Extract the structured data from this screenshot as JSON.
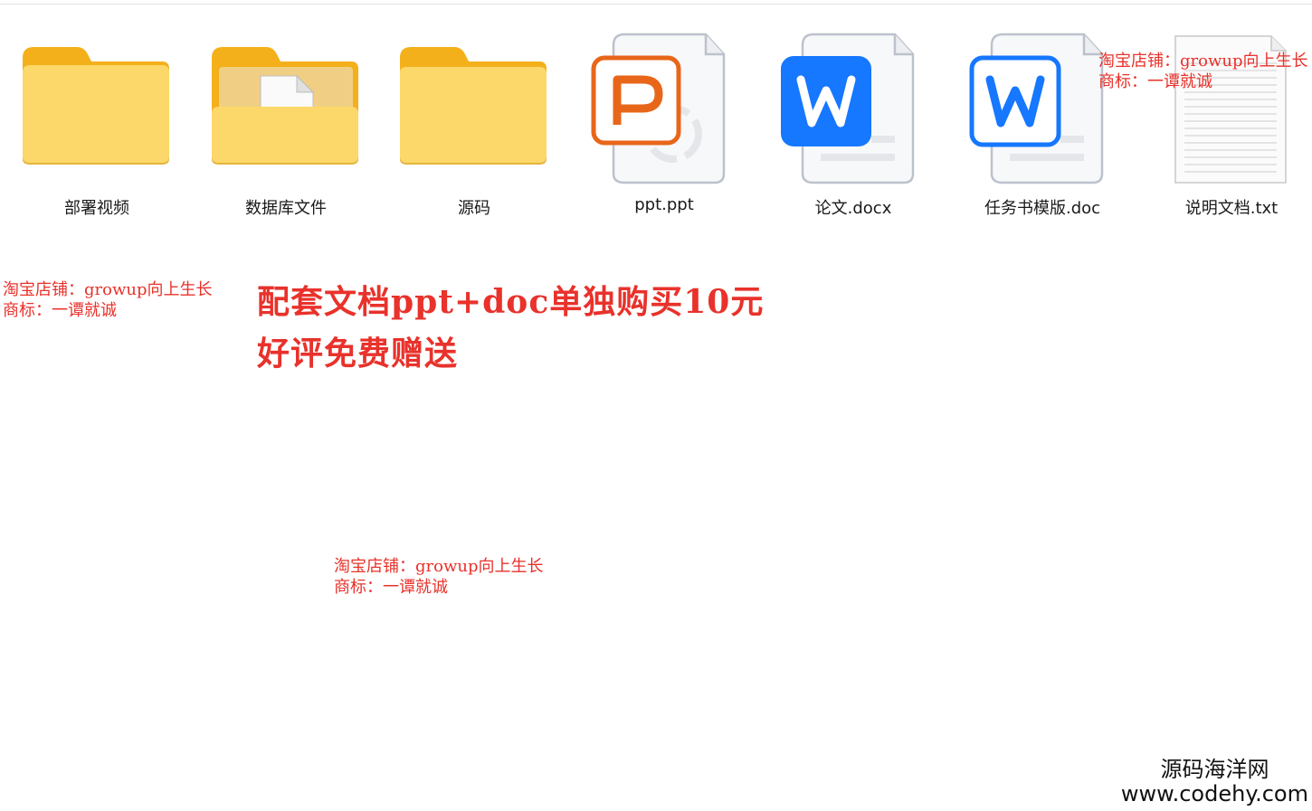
{
  "files": [
    {
      "name": "部署视频",
      "type": "folder"
    },
    {
      "name": "数据库文件",
      "type": "folder-with-document"
    },
    {
      "name": "源码",
      "type": "folder"
    },
    {
      "name": "ppt.ppt",
      "type": "wps-presentation-file",
      "accent": "#e8661a"
    },
    {
      "name": "论文.docx",
      "type": "wps-writer-file-filled",
      "accent": "#1677ff"
    },
    {
      "name": "任务书模版.doc",
      "type": "wps-writer-file-outline",
      "accent": "#1677ff"
    },
    {
      "name": "说明文档.txt",
      "type": "text-file"
    }
  ],
  "watermarks": {
    "top_right": {
      "line1": "淘宝店铺：growup向上生长",
      "line2": "商标：一谭就诚"
    },
    "left": {
      "line1": "淘宝店铺：growup向上生长",
      "line2": "商标：一谭就诚"
    },
    "center": {
      "line1": "淘宝店铺：growup向上生长",
      "line2": "商标：一谭就诚"
    }
  },
  "promo": {
    "line1": "配套文档ppt+doc单独购买10元",
    "line2": "好评免费赠送"
  },
  "site_brand": {
    "name": "源码海洋网",
    "url": "www.codehy.com"
  },
  "colors": {
    "watermark_red": "#e8322b",
    "folder_yellow": "#fcd86a",
    "ppt_orange": "#e8661a",
    "wps_blue": "#1677ff"
  }
}
